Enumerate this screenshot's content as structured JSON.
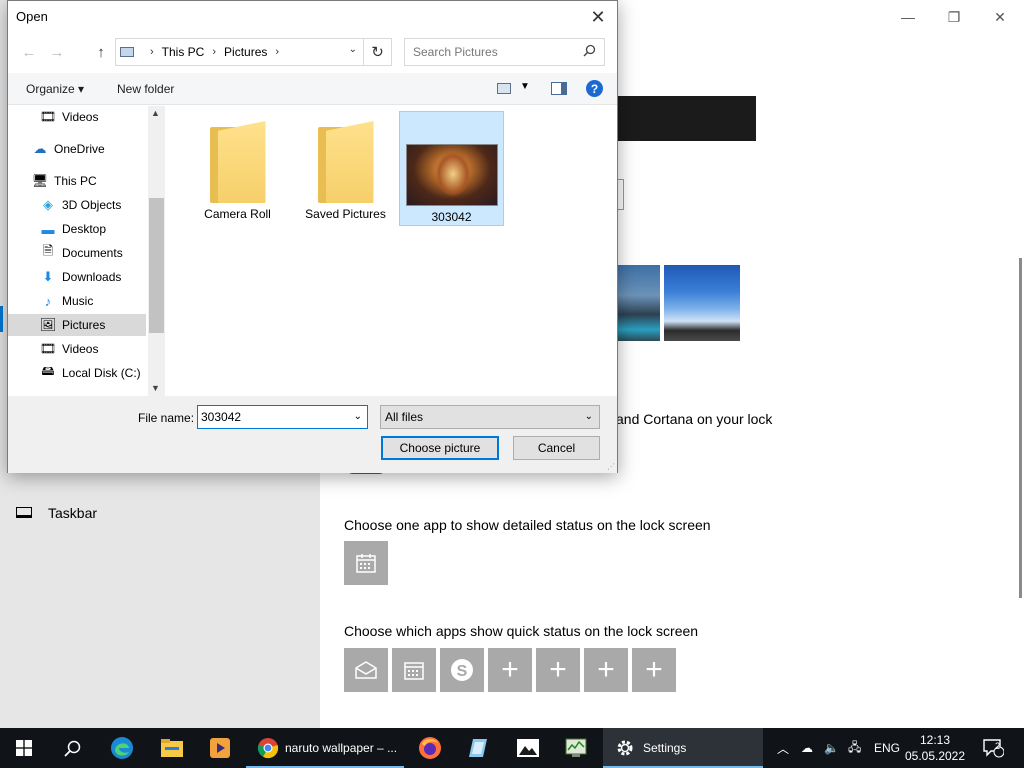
{
  "settings": {
    "cortana_text": "and Cortana on your lock",
    "taskbar_nav_label": "Taskbar",
    "detailed_status_label": "Choose one app to show detailed status on the lock screen",
    "quick_status_label": "Choose which apps show quick status on the lock screen",
    "window_controls": {
      "minimize": "—",
      "restore": "❐",
      "close": "✕"
    }
  },
  "dialog": {
    "title": "Open",
    "close_glyph": "✕",
    "nav": {
      "back": "←",
      "forward": "→",
      "up": "↑"
    },
    "address": {
      "crumbs": [
        "This PC",
        "Pictures"
      ],
      "separator": "›",
      "dropdown": "⌄"
    },
    "refresh_glyph": "↻",
    "search": {
      "placeholder": "Search Pictures",
      "value": "",
      "icon": "search-icon"
    },
    "toolbar": {
      "organize": "Organize ▾",
      "new_folder": "New folder",
      "help": "?"
    },
    "nav_items": [
      {
        "label": "Videos",
        "icon": "video-icon",
        "glyph": "🎞"
      },
      {
        "label": "OneDrive",
        "icon": "cloud-icon",
        "glyph": "☁"
      },
      {
        "label": "This PC",
        "icon": "computer-icon",
        "glyph": "🖥"
      },
      {
        "label": "3D Objects",
        "icon": "cube-icon",
        "glyph": "◈"
      },
      {
        "label": "Desktop",
        "icon": "desktop-icon",
        "glyph": "▬"
      },
      {
        "label": "Documents",
        "icon": "document-icon",
        "glyph": "🗎"
      },
      {
        "label": "Downloads",
        "icon": "download-icon",
        "glyph": "⬇"
      },
      {
        "label": "Music",
        "icon": "music-icon",
        "glyph": "♪"
      },
      {
        "label": "Pictures",
        "icon": "pictures-icon",
        "glyph": "🖼",
        "selected": true
      },
      {
        "label": "Videos",
        "icon": "video-icon",
        "glyph": "🎞"
      },
      {
        "label": "Local Disk (C:)",
        "icon": "disk-icon",
        "glyph": "🖴"
      }
    ],
    "files": [
      {
        "label": "Camera Roll",
        "type": "folder"
      },
      {
        "label": "Saved Pictures",
        "type": "folder"
      },
      {
        "label": "303042",
        "type": "image",
        "selected": true
      }
    ],
    "file_name_label": "File name:",
    "file_name_value": "303042",
    "file_type": "All files",
    "choose_button": "Choose picture",
    "cancel_button": "Cancel"
  },
  "taskbar": {
    "apps": [
      {
        "label": "naruto wallpaper – ...",
        "icon": "chrome-icon"
      },
      {
        "label": "Settings",
        "icon": "settings-icon",
        "active": true
      }
    ],
    "language": "ENG",
    "time": "12:13",
    "date": "05.05.2022",
    "notification_count": "2"
  },
  "colors": {
    "accent": "#0078d7",
    "taskbar": "#101419",
    "selection": "#cce8ff"
  }
}
